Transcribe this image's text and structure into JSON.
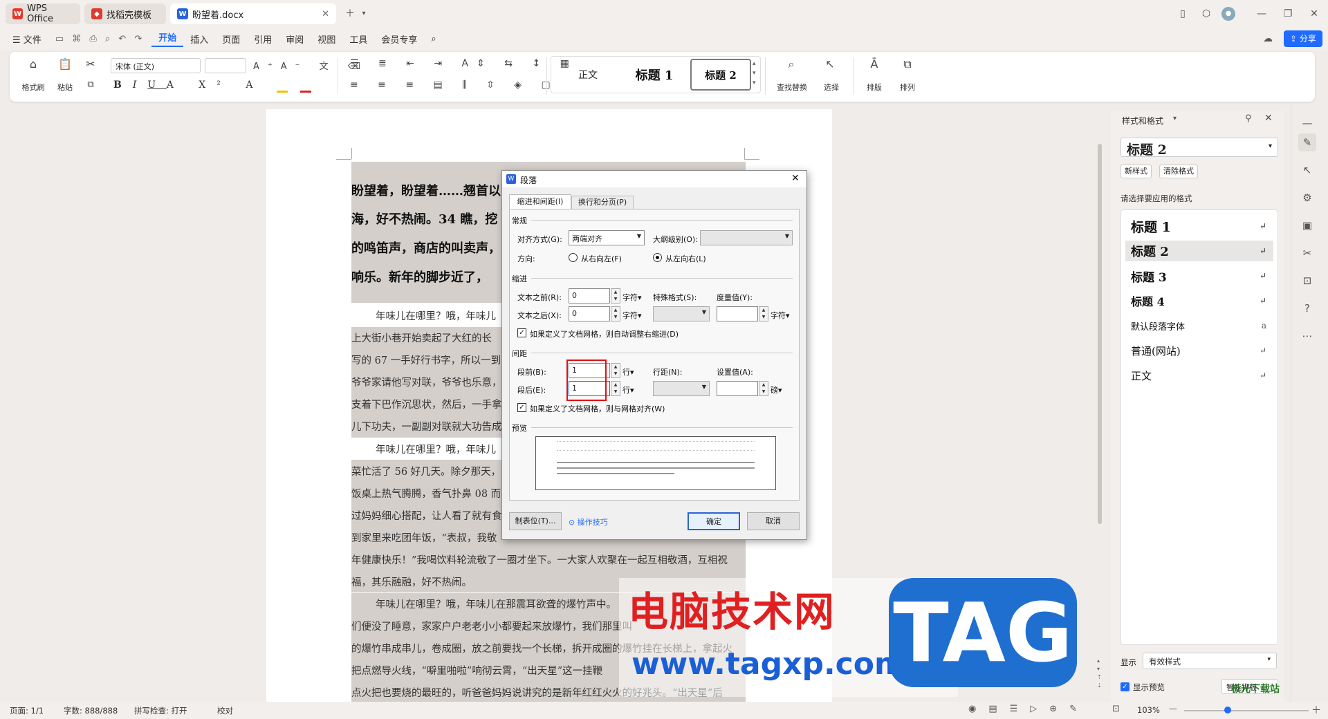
{
  "tabs": [
    {
      "label": "WPS Office"
    },
    {
      "label": "找稻壳模板"
    },
    {
      "label": "盼望着.docx"
    }
  ],
  "menu": [
    "文件",
    "开始",
    "插入",
    "页面",
    "引用",
    "审阅",
    "视图",
    "工具",
    "会员专享"
  ],
  "share": "分享",
  "ribbon": {
    "format_painter": "格式刷",
    "paste": "粘贴",
    "font": "宋体 (正文)",
    "font_size": "",
    "styles": [
      "正文",
      "标题 1",
      "标题 2"
    ],
    "find_replace": "查找替换",
    "select": "选择",
    "layout": "排版",
    "arrange": "排列"
  },
  "doc": {
    "heading_lines": [
      "盼望着，盼望着……翘首以",
      "海，好不热闹。34 瞧，挖",
      "的鸣笛声，商店的叫卖声，",
      "响乐。新年的脚步近了，"
    ],
    "body_lines": [
      "年味儿在哪里？哦，年味儿",
      "上大街小巷开始卖起了大红的长",
      "写的 67 一手好行书字，所以一到",
      "爷爷家请他写对联，爷爷也乐意，",
      "支着下巴作沉思状，然后，一手拿",
      "儿下功夫，一副副对联就大功告成",
      "年味儿在哪里？哦，年味儿",
      "菜忙活了 56 好几天。除夕那天，",
      "饭桌上热气腾腾，香气扑鼻 08 而",
      "过妈妈细心搭配，让人看了就有食",
      "到家里来吃团年饭，“表叔，我敬",
      "年健康快乐！”我喝饮料轮流敬了一圈才坐下。一大家人欢聚在一起互相敬酒，互相祝",
      "福，其乐融融，好不热闹。",
      "年味儿在哪里？哦，年味儿在那震耳欲聋的爆竹声中。",
      "们便没了睡意，家家户户老老小小都要起来放爆竹，我们那里叫",
      "的爆竹串成串儿，卷成圈，放之前要找一个长梯，拆开成圈的爆竹挂在长梯上，拿起火",
      "把点燃导火线，“噼里啪啦”响彻云霄，“出天星”这一挂鞭",
      "点火把也要烧的最旺的，听爸爸妈妈说讲究的是新年红红火火的好兆头。“出天星”后"
    ]
  },
  "panel": {
    "title": "样式和格式",
    "current": "标题 2",
    "new_style": "新样式",
    "clear_format": "清除格式",
    "prompt": "请选择要应用的格式",
    "styles": [
      "标题 1",
      "标题 2",
      "标题 3",
      "标题 4",
      "默认段落字体",
      "普通(网站)",
      "正文"
    ],
    "show_label": "显示",
    "show_value": "有效样式",
    "preview_label": "显示预览",
    "smart_layout": "智能排版"
  },
  "status": {
    "page": "页面: 1/1",
    "words": "字数: 888/888",
    "spell": "拼写检查: 打开",
    "proof": "校对",
    "zoom": "103%"
  },
  "dialog": {
    "title": "段落",
    "tab1": "缩进和间距(I)",
    "tab2": "换行和分页(P)",
    "sec_general": "常规",
    "align_label": "对齐方式(G):",
    "align_value": "两端对齐",
    "outline_label": "大纲级别(O):",
    "dir_label": "方向:",
    "dir_rtl": "从右向左(F)",
    "dir_ltr": "从左向右(L)",
    "sec_indent": "缩进",
    "before_text": "文本之前(R):",
    "before_val": "0",
    "unit_char": "字符▾",
    "special": "特殊格式(S):",
    "measure": "度量值(Y):",
    "after_text": "文本之后(X):",
    "after_val": "0",
    "grid_indent": "如果定义了文档网格，则自动调整右缩进(D)",
    "sec_spacing": "间距",
    "space_before": "段前(B):",
    "space_before_val": "1",
    "unit_line": "行▾",
    "line_spacing": "行距(N):",
    "set_value": "设置值(A):",
    "space_after": "段后(E):",
    "space_after_val": "1",
    "unit_pt": "磅▾",
    "grid_snap": "如果定义了文档网格，则与网格对齐(W)",
    "sec_preview": "预览",
    "tabs_btn": "制表位(T)...",
    "tips": "操作技巧",
    "ok": "确定",
    "cancel": "取消"
  },
  "watermark": {
    "red_text": "电脑技术网",
    "url": "www.tagxp.com",
    "tag": "TAG",
    "site": "极光下载站"
  }
}
